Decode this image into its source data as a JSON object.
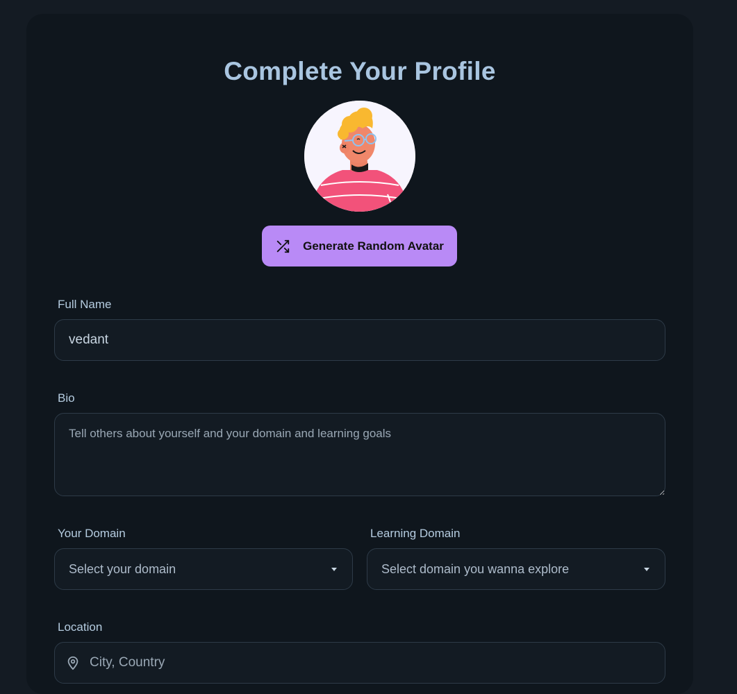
{
  "page": {
    "title": "Complete Your Profile"
  },
  "avatar": {
    "icon": "cartoon-avatar-icon"
  },
  "generate_button": {
    "label": "Generate Random Avatar",
    "icon": "shuffle-icon",
    "color": "#b98af6"
  },
  "form": {
    "full_name": {
      "label": "Full Name",
      "value": "vedant"
    },
    "bio": {
      "label": "Bio",
      "placeholder": "Tell others about yourself and your domain and learning goals"
    },
    "your_domain": {
      "label": "Your Domain",
      "selected": "Select your domain"
    },
    "learning_domain": {
      "label": "Learning Domain",
      "selected": "Select domain you wanna explore"
    },
    "location": {
      "label": "Location",
      "placeholder": "City, Country",
      "icon": "map-pin-icon"
    }
  },
  "colors": {
    "background": "#141b23",
    "card": "#0f161d",
    "title": "#a9c5e0",
    "accent": "#b98af6"
  }
}
